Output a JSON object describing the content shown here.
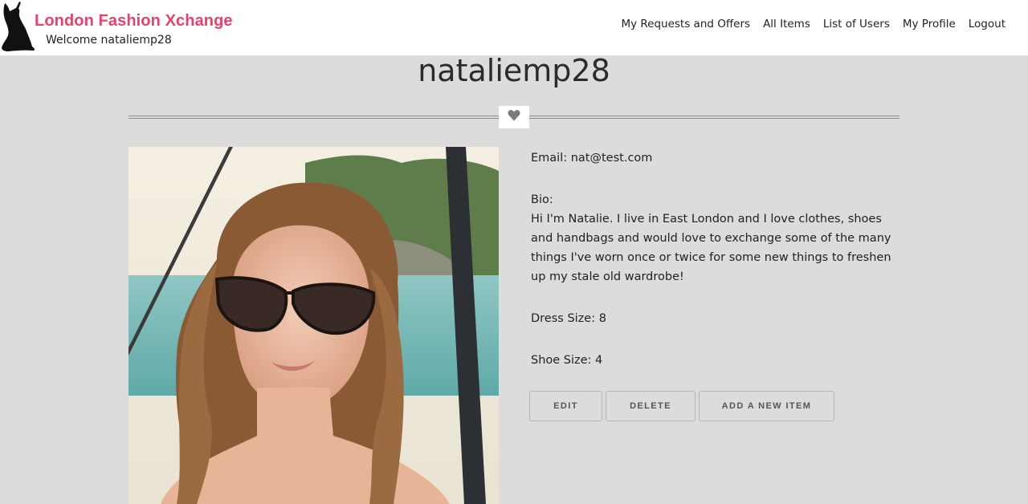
{
  "header": {
    "brand": "London Fashion Xchange",
    "welcome": "Welcome nataliemp28",
    "nav": [
      {
        "label": "My Requests and Offers"
      },
      {
        "label": "All Items"
      },
      {
        "label": "List of Users"
      },
      {
        "label": "My Profile"
      },
      {
        "label": "Logout"
      }
    ]
  },
  "profile": {
    "username": "nataliemp28",
    "email": "Email: nat@test.com",
    "bio_label": "Bio:",
    "bio_text": "Hi I'm Natalie. I live in East London and I love clothes, shoes and handbags and would love to exchange some of the many things I've worn once or twice for some new things to freshen up my stale old wardrobe!",
    "dress_size": "Dress Size: 8",
    "shoe_size": "Shoe Size: 4"
  },
  "actions": {
    "edit": "EDIT",
    "delete": "DELETE",
    "add": "ADD A NEW ITEM"
  },
  "icons": {
    "logo": "fashion-silhouette-logo-icon",
    "divider": "heart-icon"
  },
  "colors": {
    "brand": "#e8426b",
    "background": "#dcdcdc"
  }
}
